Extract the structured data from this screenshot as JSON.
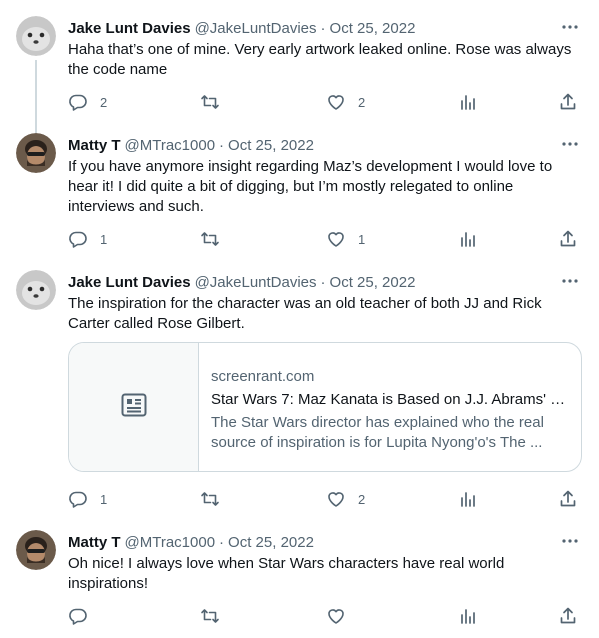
{
  "tweets": [
    {
      "name": "Jake Lunt Davies",
      "handle": "@JakeLuntDavies",
      "date": "Oct 25, 2022",
      "text": "Haha that’s one of mine. Very early artwork leaked online. Rose was always the code name",
      "replies": "2",
      "retweets": "",
      "likes": "2"
    },
    {
      "name": "Matty T",
      "handle": "@MTrac1000",
      "date": "Oct 25, 2022",
      "text": "If you have anymore insight regarding Maz’s development I would love to hear it! I did quite a bit of digging, but I’m mostly relegated to online interviews and such.",
      "replies": "1",
      "retweets": "",
      "likes": "1"
    },
    {
      "name": "Jake Lunt Davies",
      "handle": "@JakeLuntDavies",
      "date": "Oct 25, 2022",
      "text": "The inspiration for the character was an old teacher of both JJ and Rick Carter called Rose Gilbert.",
      "replies": "1",
      "retweets": "",
      "likes": "2",
      "card": {
        "domain": "screenrant.com",
        "title": "Star Wars 7: Maz Kanata is Based on J.J. Abrams' H...",
        "description": "The Star Wars director has explained who the real source of inspiration is for Lupita Nyong'o's The ..."
      }
    },
    {
      "name": "Matty T",
      "handle": "@MTrac1000",
      "date": "Oct 25, 2022",
      "text": "Oh nice! I always love when Star Wars characters have real world inspirations!",
      "replies": "",
      "retweets": "",
      "likes": ""
    }
  ],
  "separator": "·",
  "icons": {
    "more": "more-dots-icon",
    "reply": "reply-bubble-icon",
    "retweet": "retweet-icon",
    "like": "heart-icon",
    "views": "views-bars-icon",
    "share": "share-upload-icon",
    "card": "article-icon"
  },
  "colors": {
    "text": "#0f1419",
    "secondary": "#536471",
    "border": "#cfd9de",
    "thread_line": "#cfd9de"
  }
}
